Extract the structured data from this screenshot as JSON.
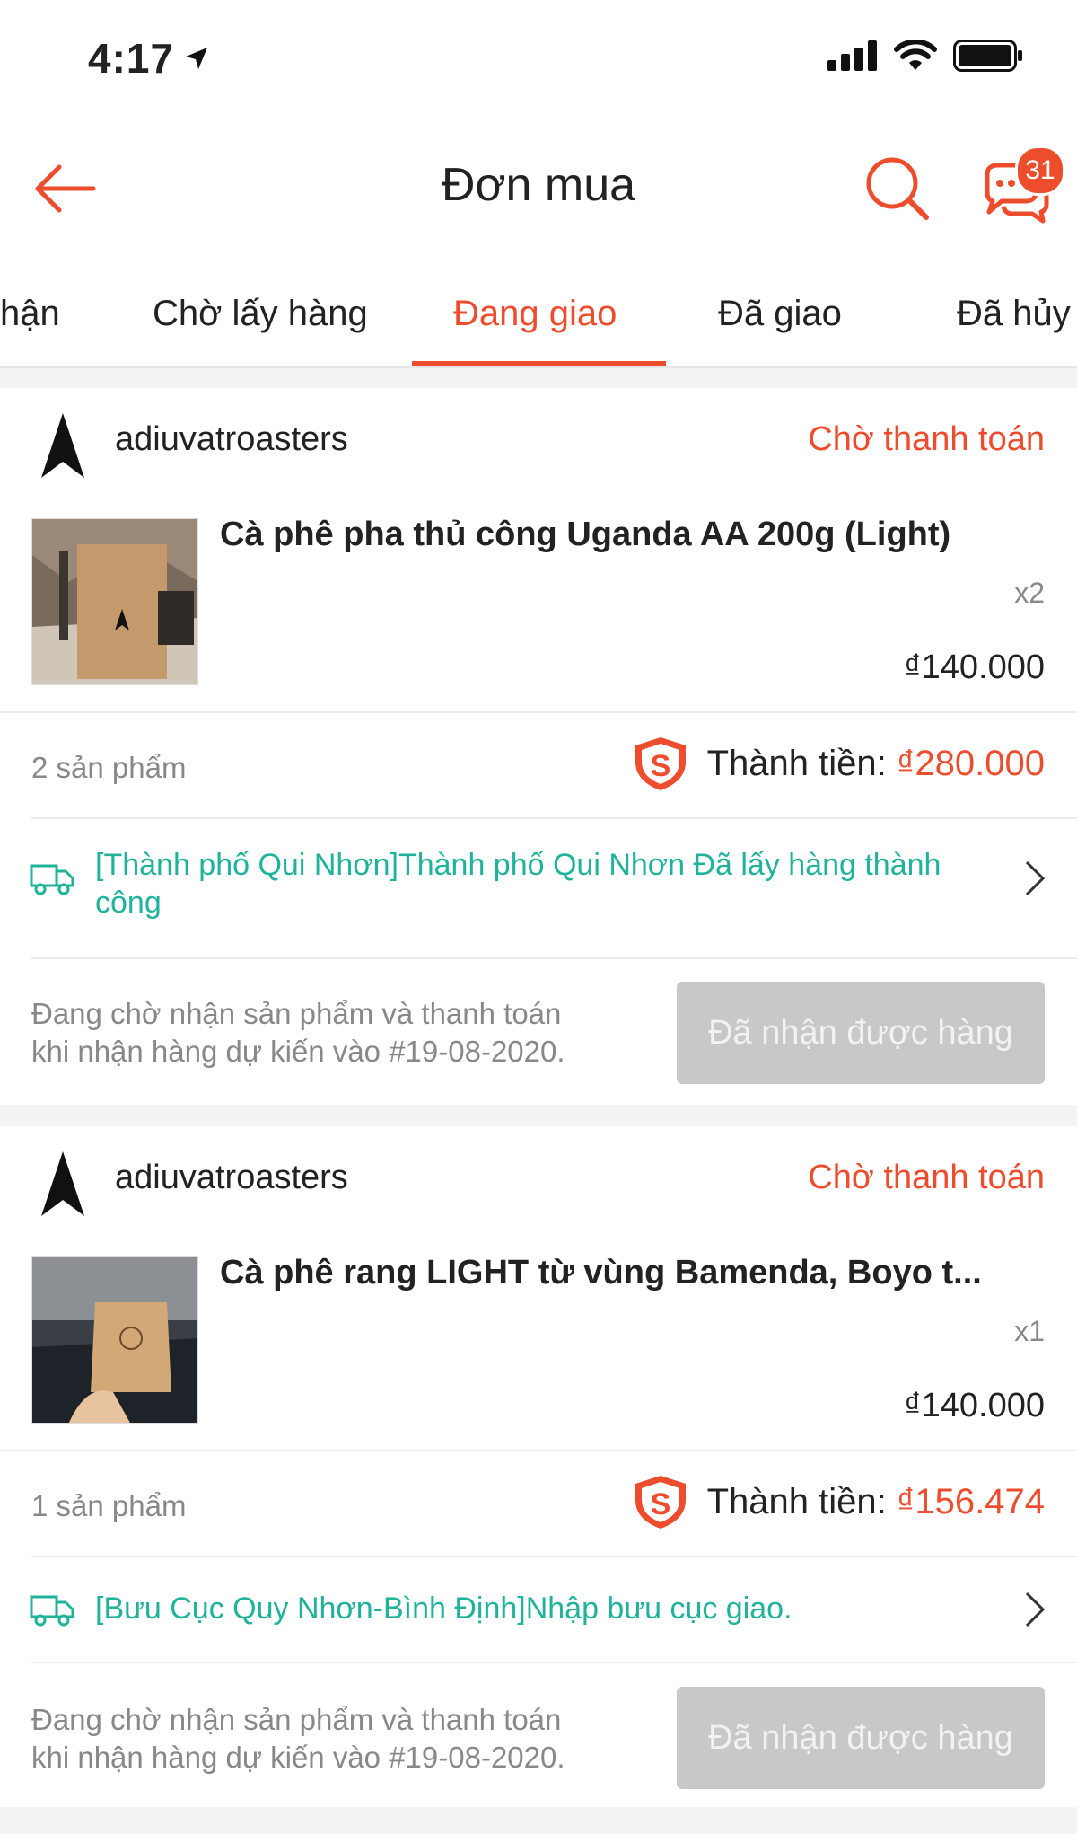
{
  "status_bar": {
    "time": "4:17"
  },
  "header": {
    "title": "Đơn mua",
    "chat_badge": "31"
  },
  "tabs": [
    {
      "label": "hận"
    },
    {
      "label": "Chờ lấy hàng"
    },
    {
      "label": "Đang giao"
    },
    {
      "label": "Đã giao"
    },
    {
      "label": "Đã hủy"
    }
  ],
  "active_tab": "Đang giao",
  "colors": {
    "accent": "#ee4d2d",
    "shipping": "#20b39b",
    "disabled_button": "#c8c8c8"
  },
  "orders": [
    {
      "shop": "adiuvatroasters",
      "status": "Chờ thanh toán",
      "product": "Cà phê pha thủ công Uganda AA 200g (Light)",
      "qty": "x2",
      "price": "₫140.000",
      "item_count": "2 sản phẩm",
      "total_label": "Thành tiền:",
      "total_value": "₫280.000",
      "shipping": "[Thành phố Qui Nhơn]Thành phố Qui Nhơn Đã lấy hàng thành công",
      "wait_line1": "Đang chờ nhận sản phẩm và thanh toán",
      "wait_line2": "khi nhận hàng dự kiến vào #19-08-2020.",
      "button": "Đã nhận được hàng"
    },
    {
      "shop": "adiuvatroasters",
      "status": "Chờ thanh toán",
      "product": "Cà phê rang LIGHT từ vùng  Bamenda, Boyo t...",
      "qty": "x1",
      "price": "₫140.000",
      "item_count": "1 sản phẩm",
      "total_label": "Thành tiền:",
      "total_value": "₫156.474",
      "shipping": "[Bưu Cục Quy Nhơn-Bình Định]Nhập bưu cục giao.",
      "wait_line1": "Đang chờ nhận sản phẩm và thanh toán",
      "wait_line2": "khi nhận hàng dự kiến vào #19-08-2020.",
      "button": "Đã nhận được hàng"
    }
  ]
}
